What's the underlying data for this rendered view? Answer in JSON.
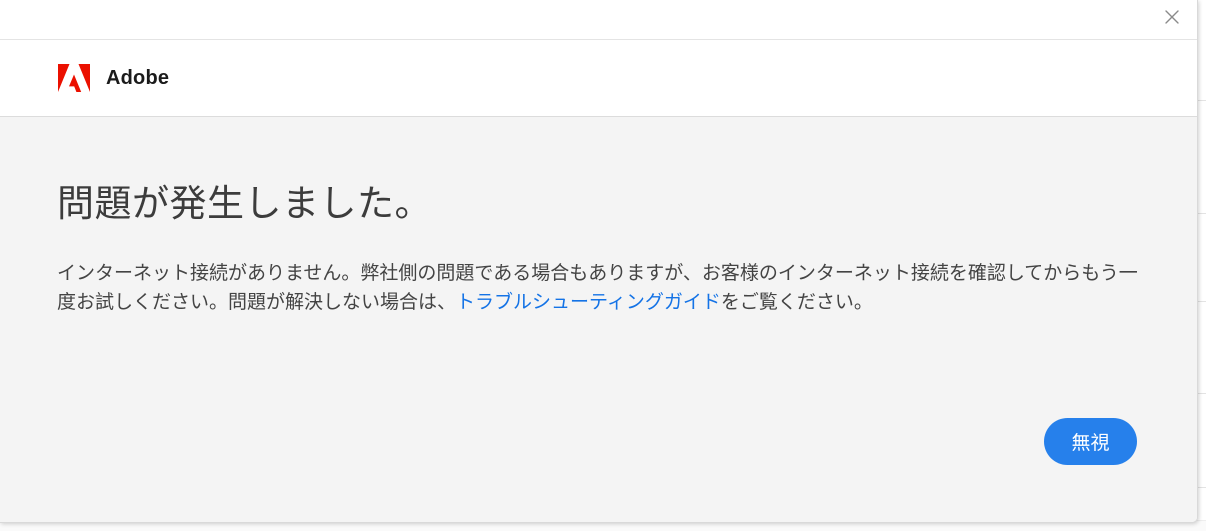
{
  "brand": {
    "name": "Adobe",
    "logo_color": "#eb1000"
  },
  "dialog": {
    "close_icon": "close-icon",
    "heading": "問題が発生しました。",
    "message_before_link": "インターネット接続がありません。弊社側の問題である場合もありますが、お客様のインターネット接続を確認してからもう一度お試しください。問題が解決しない場合は、",
    "link_text": "トラブルシューティングガイド",
    "message_after_link": "をご覧ください。",
    "ignore_button_label": "無視"
  },
  "colors": {
    "accent": "#2680eb",
    "link": "#1473e6",
    "content_bg": "#f4f4f4"
  }
}
